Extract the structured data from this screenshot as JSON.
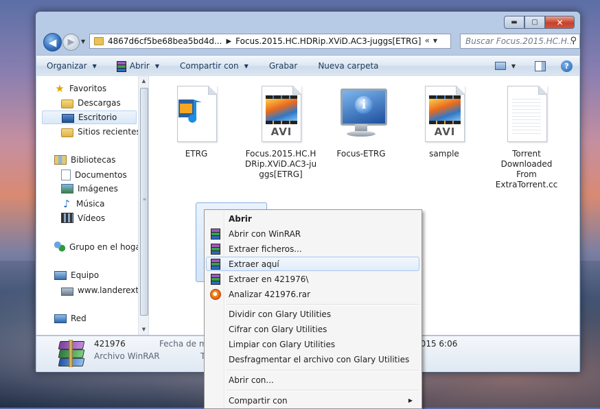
{
  "window": {
    "address_crumbs": [
      "4867d6cf5be68bea5bd4d...",
      "Focus.2015.HC.HDRip.XViD.AC3-juggs[ETRG]"
    ],
    "address_expand": "«",
    "search_placeholder": "Buscar Focus.2015.HC.H...",
    "controls": {
      "minimize": "▬",
      "maximize": "▢",
      "close": "✕"
    }
  },
  "toolbar": {
    "organize": "Organizar",
    "open": "Abrir",
    "share": "Compartir con",
    "burn": "Grabar",
    "new_folder": "Nueva carpeta",
    "help": "?"
  },
  "nav_pane": {
    "favorites": "Favoritos",
    "downloads": "Descargas",
    "desktop": "Escritorio",
    "recent": "Sitios recientes",
    "libraries": "Bibliotecas",
    "documents": "Documentos",
    "images": "Imágenes",
    "music": "Música",
    "videos": "Vídeos",
    "homegroup": "Grupo en el hogar",
    "computer": "Equipo",
    "drive": "www.landerextre",
    "network": "Red"
  },
  "files": [
    {
      "name": "ETRG",
      "icon": "audio-file-icon"
    },
    {
      "name": "Focus.2015.HC.HDRip.XViD.AC3-juggs[ETRG]",
      "icon": "avi-file-icon"
    },
    {
      "name": "Focus-ETRG",
      "icon": "info-monitor-icon"
    },
    {
      "name": "sample",
      "icon": "avi-file-icon"
    },
    {
      "name": "Torrent Downloaded From ExtraTorrent.cc",
      "icon": "text-file-icon"
    },
    {
      "name": "421976",
      "icon": "winrar-archive-icon"
    }
  ],
  "file_labels": {
    "f0": "ETRG",
    "f1": "Focus.2015.HC.H\nDRip.XViD.AC3-ju\nggs[ETRG]",
    "f2": "Focus-ETRG",
    "f3": "sample",
    "f4": "Torrent\nDownloaded\nFrom\nExtraTorrent.cc",
    "f5": "421976",
    "avi_label": "AVI"
  },
  "details": {
    "name": "421976",
    "type": "Archivo WinRAR",
    "date_label": "Fecha de mo",
    "size_label": "T",
    "date_value": "/2015 6:06"
  },
  "context_menu": {
    "open": "Abrir",
    "open_with_winrar": "Abrir con WinRAR",
    "extract_files": "Extraer ficheros...",
    "extract_here": "Extraer aquí",
    "extract_to": "Extraer en 421976\\",
    "analyze": "Analizar 421976.rar",
    "split": "Dividir con Glary Utilities",
    "encrypt": "Cifrar con Glary Utilities",
    "clean": "Limpiar con Glary Utilities",
    "defrag": "Desfragmentar el archivo con Glary Utilities",
    "open_with": "Abrir con...",
    "share_with": "Compartir con"
  },
  "colors": {
    "accent": "#3399ff",
    "selection": "#cce8ff"
  }
}
